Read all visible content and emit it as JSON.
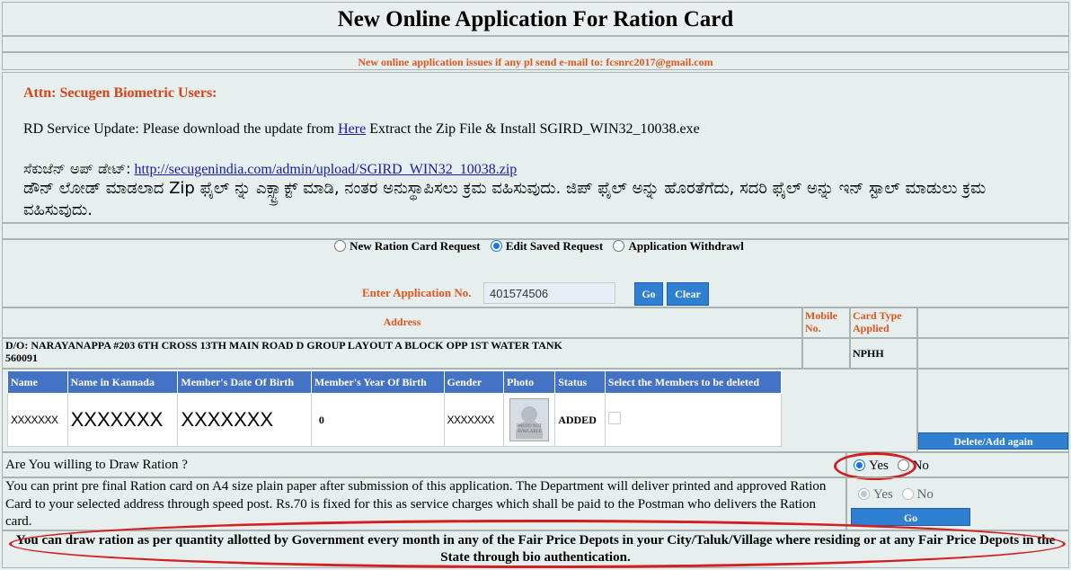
{
  "header": {
    "title": "New Online Application For Ration Card",
    "notice": "New online application issues if any pl send e-mail to: fcsnrc2017@gmail.com"
  },
  "info": {
    "attn": "Attn: Secugen Biometric Users:",
    "rd_prefix": "RD Service Update: Please download the update from",
    "rd_link": "Here",
    "rd_suffix": "Extract the Zip File & Install SGIRD_WIN32_10038.exe",
    "kn_label": "ಸೆಕುಜೆನ್ ಅಪ್ ಡೇಟ್:",
    "kn_url": "http://secugenindia.com/admin/upload/SGIRD_WIN32_10038.zip",
    "kn_text": "ಡೌನ್ ಲೋಡ್ ಮಾಡಲಾದ Zip ಫೈಲ್ ನ್ನು ಎಕ್ಸ್ಟ್ರಾಕ್ಟ್ ಮಾಡಿ, ನಂತರ ಅನುಸ್ಥಾಪಿಸಲು ಕ್ರಮ ವಹಿಸುವುದು. ಜಿಪ್ ಫೈಲ್ ಅನ್ನು ಹೊರತೆಗೆದು, ಸದರಿ ಫೈಲ್ ಅನ್ನು ಇನ್ ಸ್ಟಾಲ್ ಮಾಡುಲು ಕ್ರಮ ವಹಿಸುವುದು."
  },
  "request_options": [
    {
      "label": "New Ration Card Request",
      "selected": false
    },
    {
      "label": "Edit Saved Request",
      "selected": true
    },
    {
      "label": "Application Withdrawl",
      "selected": false
    }
  ],
  "application": {
    "label": "Enter Application No.",
    "value": "401574506",
    "go_label": "Go",
    "clear_label": "Clear"
  },
  "address_table": {
    "address_header": "Address",
    "mobile_header": "Mobile No.",
    "card_type_header": "Card Type Applied",
    "address_line1": "D/O: NARAYANAPPA #203 6TH CROSS 13TH MAIN ROAD D GROUP LAYOUT A BLOCK OPP 1ST WATER TANK",
    "address_line2": "560091",
    "mobile": "",
    "card_type": "NPHH"
  },
  "members": {
    "columns": [
      "Name",
      "Name in Kannada",
      "Member's Date Of Birth",
      "Member's Year Of Birth",
      "Gender",
      "Photo",
      "Status",
      "Select the Members to be deleted"
    ],
    "rows": [
      {
        "name": "XXXXXXX",
        "name_kn": "XXXXXXX",
        "dob": "XXXXXXX",
        "yob": "0",
        "gender": "XXXXXXX",
        "photo_text": "PHOTO NOT AVAILABLE",
        "status": "ADDED"
      }
    ],
    "delete_button": "Delete/Add again"
  },
  "draw_ration": {
    "question": "Are You willing to Draw Ration ?",
    "yes": "Yes",
    "no": "No",
    "selected": "Yes"
  },
  "print_card": {
    "text": "You can print pre final Ration card on A4 size plain paper after submission of this application. The Department will deliver printed and approved Ration Card to your selected address through speed post. Rs.70 is fixed for this as service charges which shall be paid to the Postman who delivers the Ration card.",
    "yes": "Yes",
    "no": "No",
    "go_label": "Go"
  },
  "footer": {
    "text": "You can draw ration as per quantity allotted by Government every month in any of the Fair Price Depots in your City/Taluk/Village where residing or at any Fair Price Depots in the State through bio authentication."
  },
  "colors": {
    "accent_orange": "#e0561e",
    "button_blue": "#2f7fd2",
    "header_blue": "#4472c4",
    "highlight_red": "#d21f1f"
  }
}
